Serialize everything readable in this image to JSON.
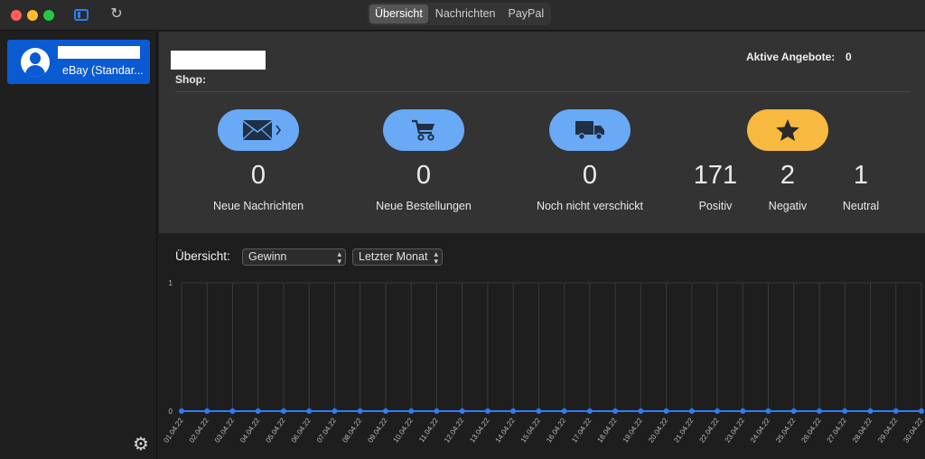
{
  "toolbar": {
    "tabs": [
      {
        "label": "Übersicht",
        "active": true
      },
      {
        "label": "Nachrichten",
        "active": false
      },
      {
        "label": "PayPal",
        "active": false
      }
    ]
  },
  "sidebar": {
    "account": {
      "type_label": "eBay (Standar..."
    }
  },
  "summary": {
    "shop_label": "Shop:",
    "active_offers_label": "Aktive Angebote:",
    "active_offers_value": "0",
    "stats": [
      {
        "value": "0",
        "label": "Neue Nachrichten"
      },
      {
        "value": "0",
        "label": "Neue Bestellungen"
      },
      {
        "value": "0",
        "label": "Noch nicht verschickt"
      }
    ],
    "ratings": [
      {
        "value": "171",
        "label": "Positiv"
      },
      {
        "value": "2",
        "label": "Negativ"
      },
      {
        "value": "1",
        "label": "Neutral"
      }
    ]
  },
  "chart_panel": {
    "label": "Übersicht:",
    "metric_select": "Gewinn",
    "period_select": "Letzter Monat"
  },
  "colors": {
    "accent_blue": "#69a9f5",
    "rating_orange": "#f7b93f",
    "line": "#2f7cf6"
  },
  "chart_data": {
    "type": "line",
    "categories": [
      "01.04.22",
      "02.04.22",
      "03.04.22",
      "04.04.22",
      "05.04.22",
      "06.04.22",
      "07.04.22",
      "08.04.22",
      "09.04.22",
      "10.04.22",
      "11.04.22",
      "12.04.22",
      "13.04.22",
      "14.04.22",
      "15.04.22",
      "16.04.22",
      "17.04.22",
      "18.04.22",
      "19.04.22",
      "20.04.22",
      "21.04.22",
      "22.04.22",
      "23.04.22",
      "24.04.22",
      "25.04.22",
      "26.04.22",
      "27.04.22",
      "28.04.22",
      "29.04.22",
      "30.04.22"
    ],
    "values": [
      0,
      0,
      0,
      0,
      0,
      0,
      0,
      0,
      0,
      0,
      0,
      0,
      0,
      0,
      0,
      0,
      0,
      0,
      0,
      0,
      0,
      0,
      0,
      0,
      0,
      0,
      0,
      0,
      0,
      0
    ],
    "yticks": [
      "0",
      "1"
    ],
    "ylim": [
      0,
      1
    ],
    "grid": true
  }
}
